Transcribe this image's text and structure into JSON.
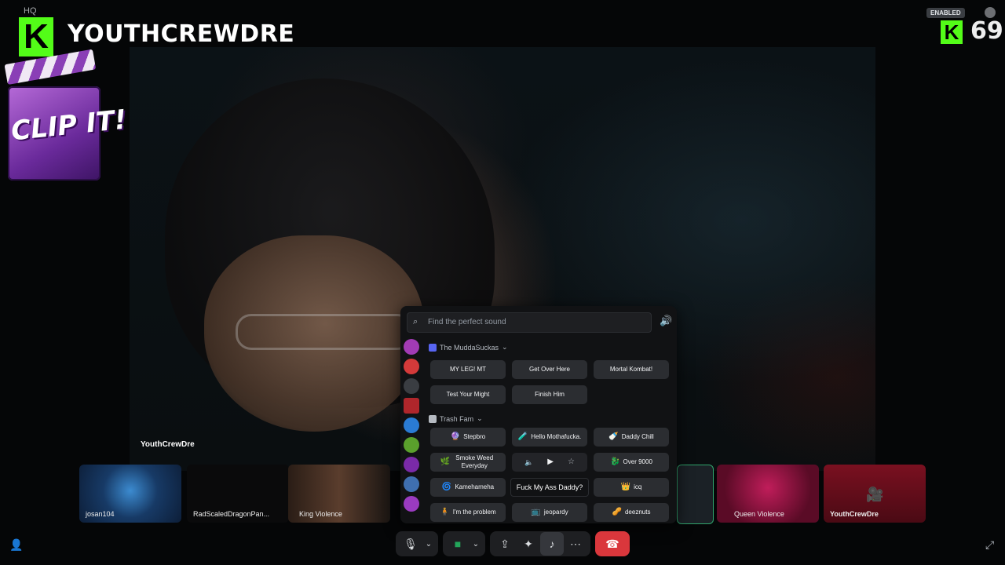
{
  "header": {
    "server_label": "HQ",
    "channel_name": "YOUTHCREWDRE",
    "kick_glyph": "K",
    "viewer_count": "69",
    "badge": "ENABLED"
  },
  "overlay": {
    "clip_text": "CLIP IT!"
  },
  "stream": {
    "streamer_name": "YouthCrewDre"
  },
  "participants": [
    {
      "name": "josan104"
    },
    {
      "name": "RadScaledDragonPan..."
    },
    {
      "name": "King Violence"
    },
    {
      "name": ""
    },
    {
      "name": "Queen Violence"
    },
    {
      "name": "YouthCrewDre"
    }
  ],
  "soundboard": {
    "search_placeholder": "Find the perfect sound",
    "categories": [
      {
        "name": "The MuddaSuckas"
      },
      {
        "name": "Trash Fam"
      }
    ],
    "muddasuckas_sounds": [
      {
        "label": "MY LEG! MT",
        "emoji": ""
      },
      {
        "label": "Get Over Here",
        "emoji": ""
      },
      {
        "label": "Mortal Kombat!",
        "emoji": ""
      },
      {
        "label": "Test Your Might",
        "emoji": ""
      },
      {
        "label": "Finish Him",
        "emoji": ""
      }
    ],
    "trashfam_sounds": [
      {
        "label": "Stepbro",
        "emoji": "🔮"
      },
      {
        "label": "Hello Mothafucka.",
        "emoji": "🧪"
      },
      {
        "label": "Daddy Chill",
        "emoji": "🍼"
      },
      {
        "label": "Smoke Weed Everyday",
        "emoji": "🌿"
      },
      {
        "label": "Fuck My Ass Daddy",
        "emoji": ""
      },
      {
        "label": "Over 9000",
        "emoji": "🐉"
      },
      {
        "label": "Kamehameha",
        "emoji": "🌀"
      },
      {
        "label": "icq",
        "emoji": "👑"
      },
      {
        "label": "I'm the problem",
        "emoji": "🧍"
      },
      {
        "label": "jeopardy",
        "emoji": "📺"
      },
      {
        "label": "deeznuts",
        "emoji": "🥜"
      }
    ],
    "tooltip": "Fuck My Ass Daddy?"
  },
  "colors": {
    "kick_green": "#53fc18",
    "hangup_red": "#da373c",
    "accent": "#5865f2"
  }
}
